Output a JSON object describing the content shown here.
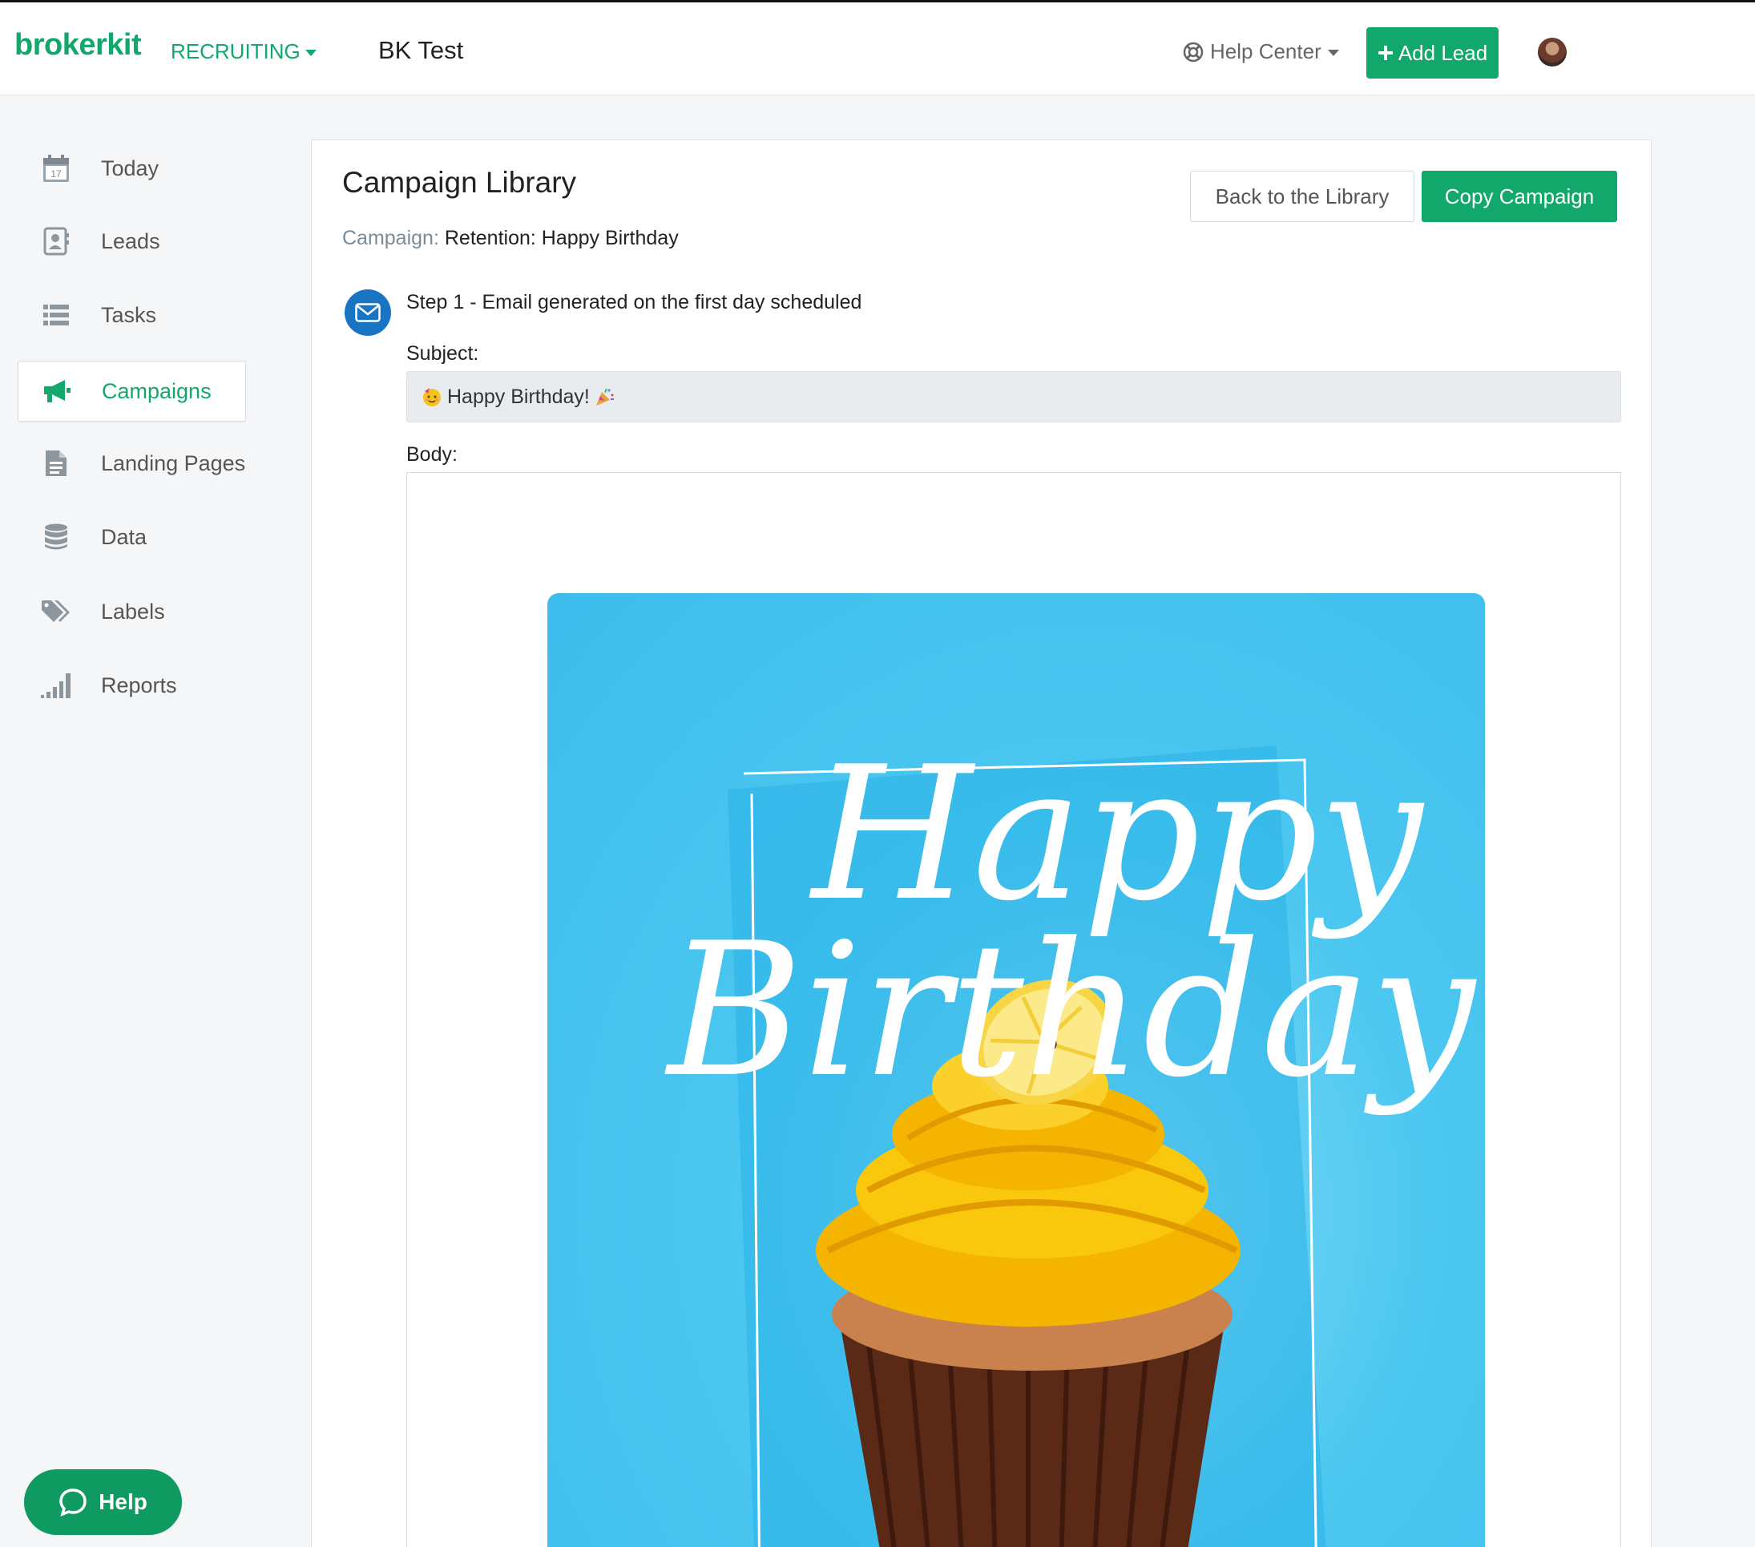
{
  "header": {
    "logo": "brokerkit",
    "product": "RECRUITING",
    "account_name": "BK Test",
    "help_center": "Help Center",
    "add_lead": "Add Lead"
  },
  "sidebar": {
    "items": [
      {
        "label": "Today",
        "icon": "calendar-icon"
      },
      {
        "label": "Leads",
        "icon": "contact-card-icon"
      },
      {
        "label": "Tasks",
        "icon": "list-icon"
      },
      {
        "label": "Campaigns",
        "icon": "megaphone-icon",
        "active": true
      },
      {
        "label": "Landing Pages",
        "icon": "document-icon"
      },
      {
        "label": "Data",
        "icon": "database-icon"
      },
      {
        "label": "Labels",
        "icon": "tags-icon"
      },
      {
        "label": "Reports",
        "icon": "bar-signal-icon"
      }
    ],
    "help_button": "Help",
    "calendar_day": "17"
  },
  "main": {
    "title": "Campaign Library",
    "campaign_key": "Campaign:",
    "campaign_value": "Retention: Happy Birthday",
    "back_button": "Back to the Library",
    "copy_button": "Copy Campaign",
    "step_label": "Step 1 - Email generated on the first day scheduled",
    "subject_label": "Subject:",
    "subject_value": "Happy Birthday!",
    "body_label": "Body:",
    "image_text_line1": "Happy",
    "image_text_line2": "Birthday"
  },
  "colors": {
    "brand_green": "#12a86b",
    "step_blue": "#1a74c4",
    "card_sky": "#45c4ef",
    "frosting": "#f5b90a"
  }
}
